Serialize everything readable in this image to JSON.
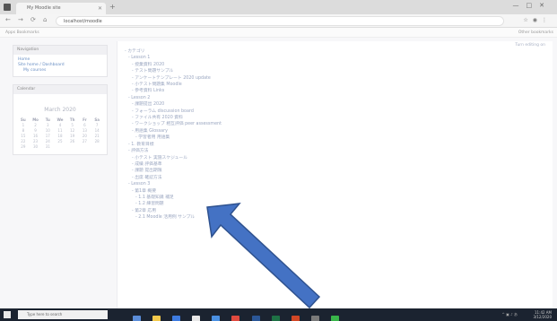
{
  "browser": {
    "tab_title": "My Moodle site",
    "address": "localhost/moodle",
    "bookmark_left": "Apps  Bookmarks",
    "bookmark_right": "Other bookmarks"
  },
  "page": {
    "action_link": "Turn editing on"
  },
  "sidebar": {
    "navigation_title": "Navigation",
    "nav_items": [
      "Home",
      "Site home / Dashboard",
      "My courses"
    ],
    "calendar_title": "Calendar",
    "calendar_month": "March 2020",
    "weekdays": [
      "Su",
      "Mo",
      "Tu",
      "We",
      "Th",
      "Fr",
      "Sa"
    ],
    "weeks": [
      [
        "1",
        "2",
        "3",
        "4",
        "5",
        "6",
        "7"
      ],
      [
        "8",
        "9",
        "10",
        "11",
        "12",
        "13",
        "14"
      ],
      [
        "15",
        "16",
        "17",
        "18",
        "19",
        "20",
        "21"
      ],
      [
        "22",
        "23",
        "24",
        "25",
        "26",
        "27",
        "28"
      ],
      [
        "29",
        "30",
        "31",
        "",
        "",
        "",
        ""
      ]
    ]
  },
  "tree": [
    "- カテゴリ",
    "  - Lesson 1",
    "    - 授業資料 2020",
    "    - テスト問題サンプル",
    "    - アンケートテンプレート 2020 update",
    "    - 小テスト問題集 Moodle",
    "    - 参考資料 Links",
    "  - Lesson 2",
    "    - 課題提出 2020",
    "    - フォーラム discussion board",
    "    - ファイル共有 2020 資料",
    "    - ワークショップ 相互評価 peer assessment",
    "    - 用語集 Glossary",
    "      - 学習者用 用語集",
    "  - 1. 教育目標",
    "  - 評価方法",
    "    - 小テスト 実施スケジュール",
    "    - 成績 評価基準",
    "    - 課題 提出期限",
    "    - 出席 確認方法",
    "  - Lesson 3",
    "    - 第1章 概要",
    "      - 1.1 基礎知識 補足",
    "      - 1.2 練習問題",
    "    - 第2章 応用",
    "      - 2.1 Moodle 活用例 サンプル"
  ],
  "taskbar": {
    "search_placeholder": "Type here to search",
    "time": "11:42 AM",
    "date": "3/12/2020"
  },
  "colors": {
    "arrow_fill": "#4472c4",
    "arrow_stroke": "#2f528f",
    "link": "#6a8fc4"
  }
}
